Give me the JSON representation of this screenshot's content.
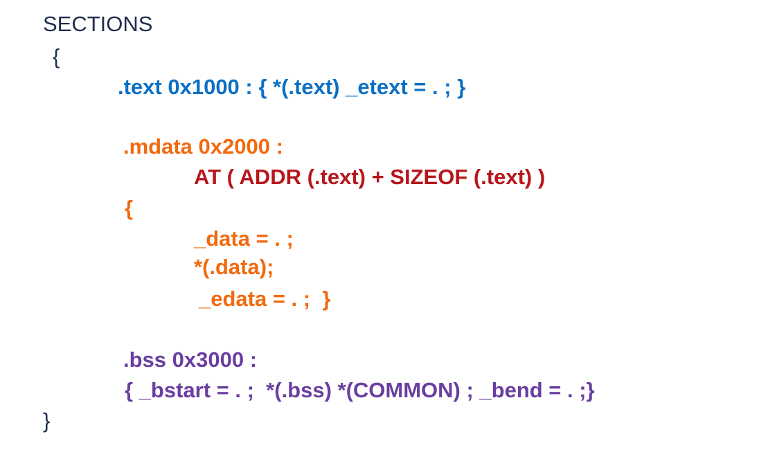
{
  "script": {
    "keyword": "SECTIONS",
    "open_brace": "{",
    "text_line": ".text 0x1000 : { *(.text) _etext = . ; }",
    "mdata_header": ".mdata 0x2000 :",
    "mdata_at": "AT ( ADDR (.text) + SIZEOF (.text) )",
    "mdata_open_brace": "{",
    "mdata_data": "_data = . ;",
    "mdata_input": "*(.data);",
    "mdata_edata": "_edata = . ;  }",
    "bss_header": ".bss 0x3000 :",
    "bss_body": "{ _bstart = . ;  *(.bss) *(COMMON) ; _bend = . ;}",
    "close_brace": "}"
  },
  "colors": {
    "keyword": "#1f2d4d",
    "text_section": "#0b6fc4",
    "mdata_section": "#f26a0f",
    "at_clause": "#b7171b",
    "bss_section": "#6a3ea0"
  }
}
